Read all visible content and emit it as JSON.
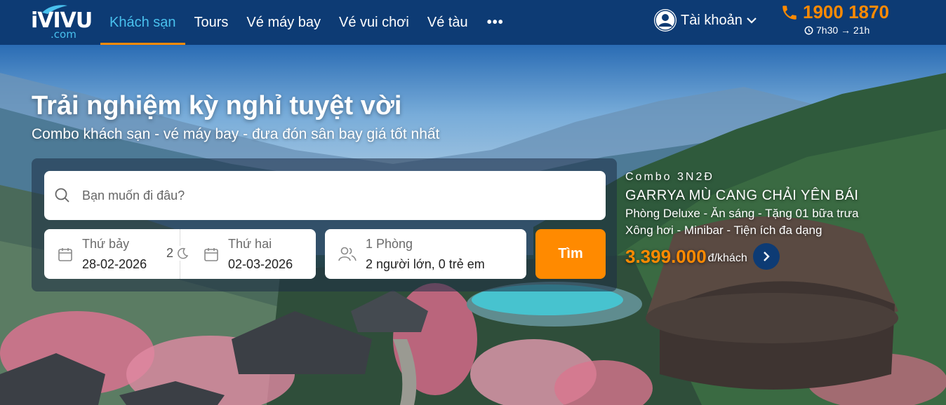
{
  "brand": {
    "logo_main": "iVIVU",
    "logo_sub": ".com"
  },
  "nav": {
    "items": [
      {
        "label": "Khách sạn"
      },
      {
        "label": "Tours"
      },
      {
        "label": "Vé máy bay"
      },
      {
        "label": "Vé vui chơi"
      },
      {
        "label": "Vé tàu"
      }
    ],
    "more_label": "•••"
  },
  "account": {
    "label": "Tài khoản"
  },
  "hotline": {
    "phone": "1900 1870",
    "hours": "7h30 → 21h"
  },
  "hero": {
    "title": "Trải nghiệm kỳ nghỉ tuyệt vời",
    "subtitle": "Combo khách sạn - vé máy bay - đưa đón sân bay giá tốt nhất"
  },
  "search": {
    "destination_placeholder": "Bạn muốn đi đâu?",
    "checkin_label": "Thứ bảy",
    "checkin_value": "28-02-2026",
    "nights": "2",
    "checkout_label": "Thứ hai",
    "checkout_value": "02-03-2026",
    "rooms": "1 Phòng",
    "guests": "2 người lớn, 0 trẻ em",
    "button_label": "Tìm"
  },
  "promo": {
    "tag": "Combo 3N2Đ",
    "name": "GARRYA MÙ CANG CHẢI YÊN BÁI",
    "line1": "Phòng Deluxe - Ăn sáng - Tặng 01 bữa trưa",
    "line2": "Xông hơi - Minibar - Tiện ích đa dạng",
    "price": "3.399.000",
    "unit": "đ/khách"
  },
  "colors": {
    "header": "#0d3b74",
    "accent": "#ff8a00",
    "active_nav": "#49c1ee"
  }
}
